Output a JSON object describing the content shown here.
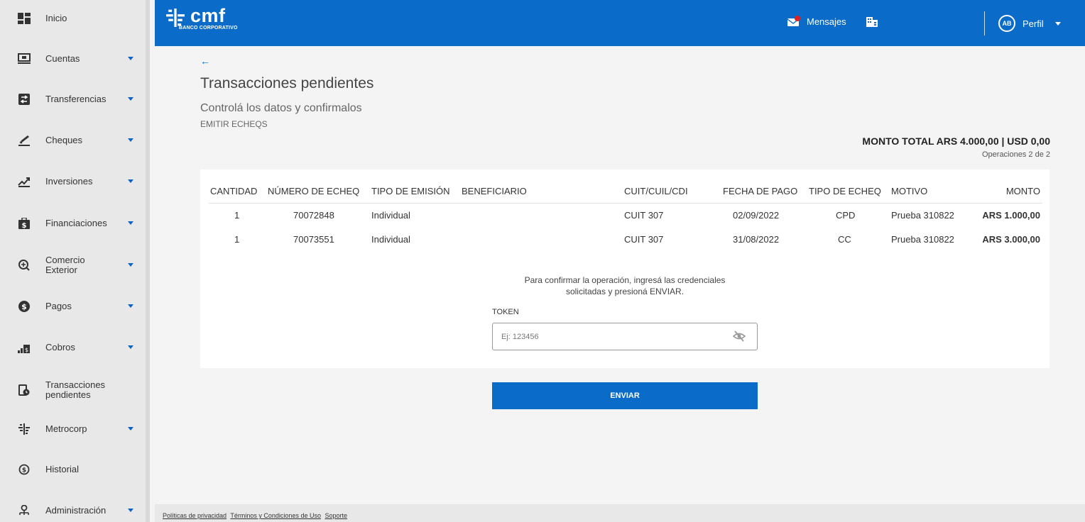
{
  "sidebar": {
    "items": [
      {
        "label": "Inicio",
        "icon": "dashboard-icon",
        "has_caret": false
      },
      {
        "label": "Cuentas",
        "icon": "accounts-icon",
        "has_caret": true
      },
      {
        "label": "Transferencias",
        "icon": "transfer-icon",
        "has_caret": true
      },
      {
        "label": "Cheques",
        "icon": "cheque-icon",
        "has_caret": true
      },
      {
        "label": "Inversiones",
        "icon": "investment-icon",
        "has_caret": true
      },
      {
        "label": "Financiaciones",
        "icon": "financing-icon",
        "has_caret": true
      },
      {
        "label": "Comercio Exterior",
        "icon": "foreign-trade-icon",
        "has_caret": true
      },
      {
        "label": "Pagos",
        "icon": "payments-icon",
        "has_caret": true
      },
      {
        "label": "Cobros",
        "icon": "collections-icon",
        "has_caret": true
      },
      {
        "label": "Transacciones pendientes",
        "icon": "pending-transactions-icon",
        "has_caret": false
      },
      {
        "label": "Metrocorp",
        "icon": "metrocorp-icon",
        "has_caret": true
      },
      {
        "label": "Historial",
        "icon": "history-icon",
        "has_caret": false
      },
      {
        "label": "Administración",
        "icon": "administration-icon",
        "has_caret": true
      }
    ]
  },
  "header": {
    "logo_text": "cmf",
    "logo_sub": "BANCO CORPORATIVO",
    "messages_label": "Mensajes",
    "avatar_initials": "AB",
    "profile_label": "Perfil"
  },
  "page": {
    "back_arrow": "←",
    "title": "Transacciones pendientes",
    "subtitle": "Controlá los datos y confirmalos",
    "kind": "EMITIR ECHEQS",
    "total_label": "MONTO TOTAL",
    "total_value": "ARS 4.000,00 | USD 0,00",
    "operations": "Operaciones 2 de 2"
  },
  "table": {
    "headers": [
      "CANTIDAD",
      "NÚMERO DE ECHEQ",
      "TIPO DE EMISIÓN",
      "BENEFICIARIO",
      "CUIT/CUIL/CDI",
      "FECHA DE PAGO",
      "TIPO DE ECHEQ",
      "MOTIVO",
      "MONTO"
    ],
    "rows": [
      {
        "cantidad": "1",
        "numero": "70072848",
        "tipo_emision": "Individual",
        "beneficiario": "",
        "cuit": "CUIT 307",
        "fecha": "02/09/2022",
        "tipo_echeq": "CPD",
        "motivo": "Prueba 310822",
        "monto": "ARS 1.000,00"
      },
      {
        "cantidad": "1",
        "numero": "70073551",
        "tipo_emision": "Individual",
        "beneficiario": "",
        "cuit": "CUIT 307",
        "fecha": "31/08/2022",
        "tipo_echeq": "CC",
        "motivo": "Prueba 310822",
        "monto": "ARS 3.000,00"
      }
    ]
  },
  "confirm": {
    "line1": "Para confirmar la operación, ingresá las credenciales",
    "line2": "solicitadas y presioná ENVIAR.",
    "token_label": "TOKEN",
    "token_placeholder": "Ej: 123456",
    "token_value": "",
    "send_label": "ENVIAR"
  },
  "footer": {
    "links": [
      "Políticas de privacidad",
      "Términos y Condiciones de Uso",
      "Soporte"
    ]
  },
  "colors": {
    "brand_blue": "#0a6bc8",
    "sidebar_bg": "#e8e8e8",
    "page_bg": "#f4f4f4"
  }
}
